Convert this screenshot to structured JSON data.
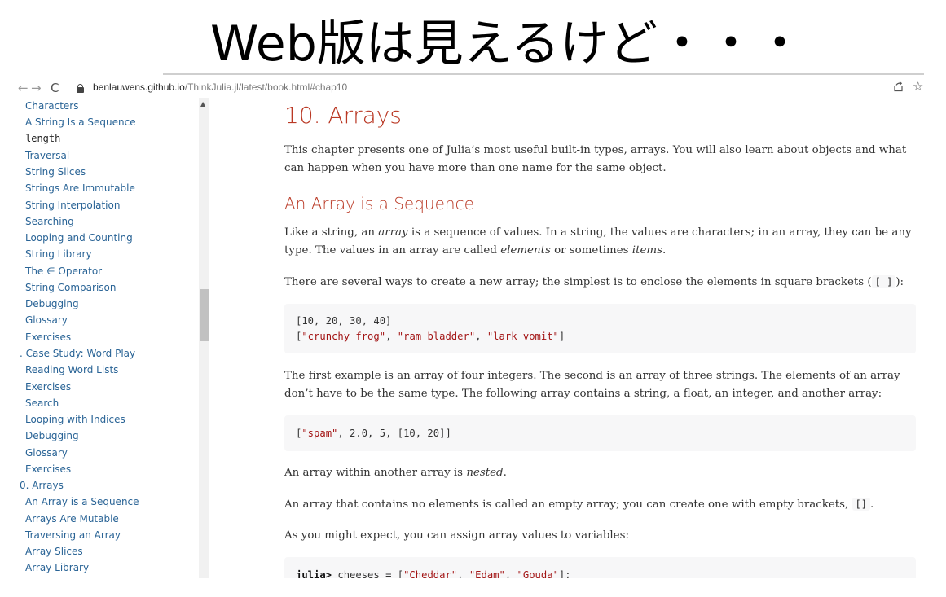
{
  "slide": {
    "title": "Web版は見えるけど・・・"
  },
  "browser": {
    "back_icon": "←",
    "forward_icon": "→",
    "reload_icon": "C",
    "url_host": "benlauwens.github.io",
    "url_path": "/ThinkJulia.jl/latest/book.html#chap10",
    "share_icon": "share-icon",
    "star_icon": "☆"
  },
  "sidebar": {
    "items": [
      {
        "label": "Characters"
      },
      {
        "label": "A String Is a Sequence"
      },
      {
        "label": "length"
      },
      {
        "label": "Traversal"
      },
      {
        "label": "String Slices"
      },
      {
        "label": "Strings Are Immutable"
      },
      {
        "label": "String Interpolation"
      },
      {
        "label": "Searching"
      },
      {
        "label": "Looping and Counting"
      },
      {
        "label": "String Library"
      },
      {
        "label": "The ∈ Operator"
      },
      {
        "label": "String Comparison"
      },
      {
        "label": "Debugging"
      },
      {
        "label": "Glossary"
      },
      {
        "label": "Exercises"
      },
      {
        "label": ". Case Study: Word Play"
      },
      {
        "label": "Reading Word Lists"
      },
      {
        "label": "Exercises"
      },
      {
        "label": "Search"
      },
      {
        "label": "Looping with Indices"
      },
      {
        "label": "Debugging"
      },
      {
        "label": "Glossary"
      },
      {
        "label": "Exercises"
      },
      {
        "label": "0. Arrays"
      },
      {
        "label": "An Array is a Sequence"
      },
      {
        "label": "Arrays Are Mutable"
      },
      {
        "label": "Traversing an Array"
      },
      {
        "label": "Array Slices"
      },
      {
        "label": "Array Library"
      }
    ]
  },
  "content": {
    "chapter_title": "10. Arrays",
    "intro": "This chapter presents one of Julia’s most useful built-in types, arrays. You will also learn about objects and what can happen when you have more than one name for the same object.",
    "section_title": "An Array is a Sequence",
    "p1_a": "Like a string, an ",
    "p1_em1": "array",
    "p1_b": " is a sequence of values. In a string, the values are characters; in an array, they can be any type. The values in an array are called ",
    "p1_em2": "elements",
    "p1_c": " or sometimes ",
    "p1_em3": "items",
    "p1_d": ".",
    "p2_a": "There are several ways to create a new array; the simplest is to enclose the elements in square brackets (",
    "p2_code": "[ ]",
    "p2_b": "):",
    "code1_line1": "[10, 20, 30, 40]",
    "code1_l2_open": "[",
    "code1_l2_s1": "\"crunchy frog\"",
    "code1_l2_sep1": ", ",
    "code1_l2_s2": "\"ram bladder\"",
    "code1_l2_sep2": ", ",
    "code1_l2_s3": "\"lark vomit\"",
    "code1_l2_close": "]",
    "p3": "The first example is an array of four integers. The second is an array of three strings. The elements of an array don’t have to be the same type. The following array contains a string, a float, an integer, and another array:",
    "code2_open": "[",
    "code2_s1": "\"spam\"",
    "code2_rest": ", 2.0, 5, [10, 20]]",
    "p4_a": "An array within another array is ",
    "p4_em": "nested",
    "p4_b": ".",
    "p5_a": "An array that contains no elements is called an empty array; you can create one with empty brackets, ",
    "p5_code": "[]",
    "p5_b": ".",
    "p6": "As you might expect, you can assign array values to variables:",
    "code3_prompt": "julia>",
    "code3_a": " cheeses = [",
    "code3_s1": "\"Cheddar\"",
    "code3_sep1": ", ",
    "code3_s2": "\"Edam\"",
    "code3_sep2": ", ",
    "code3_s3": "\"Gouda\"",
    "code3_end": "];"
  },
  "colors": {
    "heading": "#ba3925",
    "link": "#2a6496",
    "string_literal": "#a31515",
    "code_background": "#f7f7f8"
  }
}
